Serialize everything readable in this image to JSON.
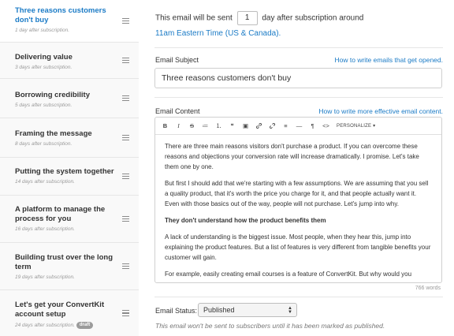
{
  "sequence": {
    "items": [
      {
        "title": "Three reasons customers don't buy",
        "subtitle": "1 day after subscription."
      },
      {
        "title": "Delivering value",
        "subtitle": "3 days after subscription."
      },
      {
        "title": "Borrowing credibility",
        "subtitle": "5 days after subscription."
      },
      {
        "title": "Framing the message",
        "subtitle": "8 days after subscription."
      },
      {
        "title": "Putting the system together",
        "subtitle": "14 days after subscription."
      },
      {
        "title": "A platform to manage the process for you",
        "subtitle": "16 days after subscription."
      },
      {
        "title": "Building trust over the long term",
        "subtitle": "19 days after subscription."
      },
      {
        "title": "Let's get your ConvertKit account setup",
        "subtitle": "24 days after subscription.",
        "badge": "draft"
      }
    ]
  },
  "schedule": {
    "prefix": "This email will be sent",
    "days": "1",
    "suffix": "day after subscription around",
    "time_link": "11am Eastern Time (US & Canada)."
  },
  "subject": {
    "label": "Email Subject",
    "help": "How to write emails that get opened.",
    "value": "Three reasons customers don't buy"
  },
  "content": {
    "label": "Email Content",
    "help": "How to write more effective email content.",
    "toolbar": {
      "bold": "B",
      "italic": "I",
      "strike": "S",
      "unordered_list": "≔",
      "ordered_list": "⒈",
      "quote": "❝",
      "image": "▣",
      "link": "🔗",
      "unlink": "⊘",
      "align": "≡",
      "hr": "—",
      "paragraph": "¶",
      "code": "<>",
      "personalize": "PERSONALIZE ▾"
    },
    "paragraphs": [
      {
        "text": "There are three main reasons visitors don't purchase a product. If you can overcome these reasons and objections your conversion rate will increase dramatically. I promise. Let's take them one by one.",
        "bold": false
      },
      {
        "text": "But first I should add that we're starting with a few assumptions. We are assuming that you sell a quality product, that it's worth the price you charge for it, and that people actually want it. Even with those basics out of the way, people will not purchase. Let's jump into why.",
        "bold": false
      },
      {
        "text": "They don't understand how the product benefits them",
        "bold": true
      },
      {
        "text": "A lack of understanding is the biggest issue. Most people, when they hear this, jump into explaining the product features. But a list of features is very different from tangible benefits your customer will gain.",
        "bold": false
      },
      {
        "text": "For example, easily creating email courses is a feature of ConvertKit. But why would you",
        "bold": false
      }
    ],
    "word_count": "766 words"
  },
  "status": {
    "label": "Email Status:",
    "value": "Published",
    "note": "This email won't be sent to subscribers until it has been marked as published."
  },
  "colors": {
    "accent": "#1b7bc6",
    "badge": "#9b9b9b"
  }
}
